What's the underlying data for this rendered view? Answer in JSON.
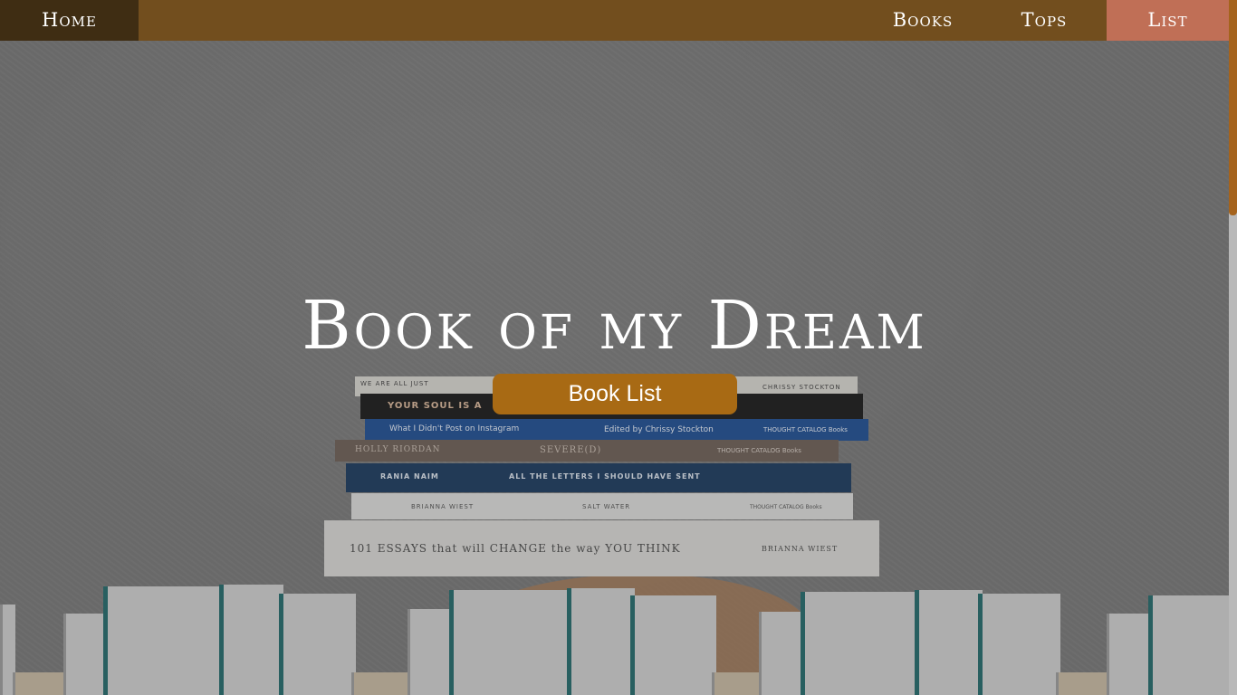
{
  "nav": {
    "home": "Home",
    "books": "Books",
    "tops": "Tops",
    "list": "List"
  },
  "hero": {
    "title": "Book of my Dream",
    "button": "Book List"
  },
  "book_spines": {
    "b1_left": "WE ARE ALL JUST",
    "b1_right": "CHRISSY STOCKTON",
    "b2": "YOUR SOUL IS A",
    "b3_left": "What I Didn't Post on Instagram",
    "b3_mid": "Edited by Chrissy Stockton",
    "b3_right": "THOUGHT CATALOG Books",
    "b4_left": "HOLLY RIORDAN",
    "b4_mid": "SEVERE(D)",
    "b4_right": "THOUGHT CATALOG Books",
    "b5_left": "RANIA NAIM",
    "b5_mid": "ALL THE LETTERS I SHOULD HAVE SENT",
    "b6_left": "BRIANNA WIEST",
    "b6_mid": "SALT WATER",
    "b6_right": "THOUGHT CATALOG Books",
    "b7_left": "101 ESSAYS that will CHANGE the way YOU THINK",
    "b7_right": "BRIANNA WIEST"
  },
  "colors": {
    "navbar": "#724e1e",
    "home_bg": "#3f2d13",
    "list_bg": "#c06f56",
    "button_bg": "#a86a14",
    "scroll_thumb": "#a5631c"
  }
}
